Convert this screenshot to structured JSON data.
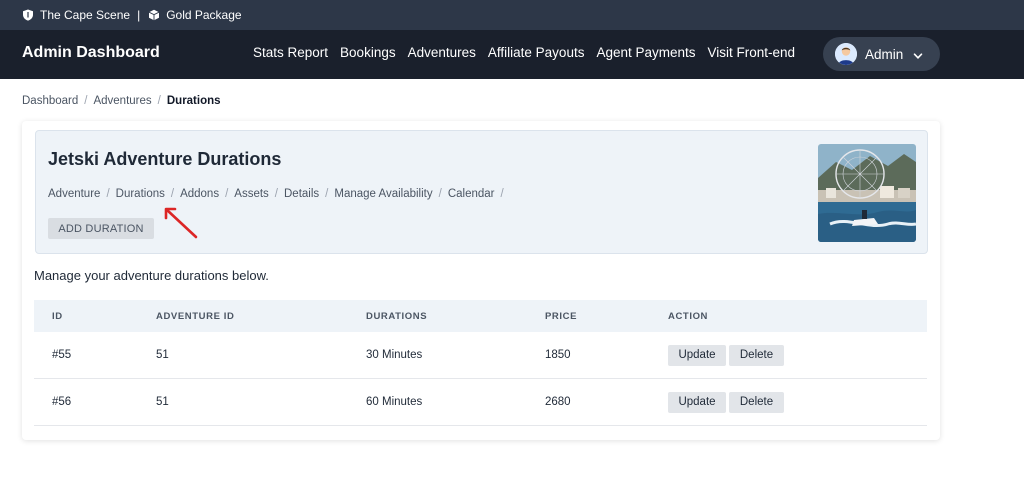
{
  "topbar": {
    "site_name": "The Cape Scene",
    "separator": "|",
    "package_name": "Gold Package"
  },
  "navbar": {
    "brand": "Admin Dashboard",
    "links": [
      "Stats Report",
      "Bookings",
      "Adventures",
      "Affiliate Payouts",
      "Agent Payments",
      "Visit Front-end"
    ],
    "user_label": "Admin"
  },
  "breadcrumb": {
    "items": [
      "Dashboard",
      "Adventures"
    ],
    "current": "Durations",
    "separator": "/"
  },
  "panel": {
    "title": "Jetski Adventure Durations",
    "subnav": [
      "Adventure",
      "Durations",
      "Addons",
      "Assets",
      "Details",
      "Manage Availability",
      "Calendar"
    ],
    "separator": "/",
    "add_button": "ADD DURATION"
  },
  "intro_text": "Manage your adventure durations below.",
  "table": {
    "headers": [
      "ID",
      "ADVENTURE ID",
      "DURATIONS",
      "PRICE",
      "ACTION"
    ],
    "rows": [
      {
        "id": "#55",
        "adventure_id": "51",
        "duration": "30 Minutes",
        "price": "1850"
      },
      {
        "id": "#56",
        "adventure_id": "51",
        "duration": "60 Minutes",
        "price": "2680"
      }
    ],
    "update_label": "Update",
    "delete_label": "Delete"
  },
  "colors": {
    "topbar_bg": "#2d3748",
    "navbar_bg": "#1a202c",
    "panel_bg": "#eef3f8",
    "annotation_arrow": "#dc2626"
  },
  "icons": {
    "site": "shield-icon",
    "package": "box-icon",
    "user_menu": "chevron-down-icon",
    "annotation": "arrow-annotation-icon"
  }
}
